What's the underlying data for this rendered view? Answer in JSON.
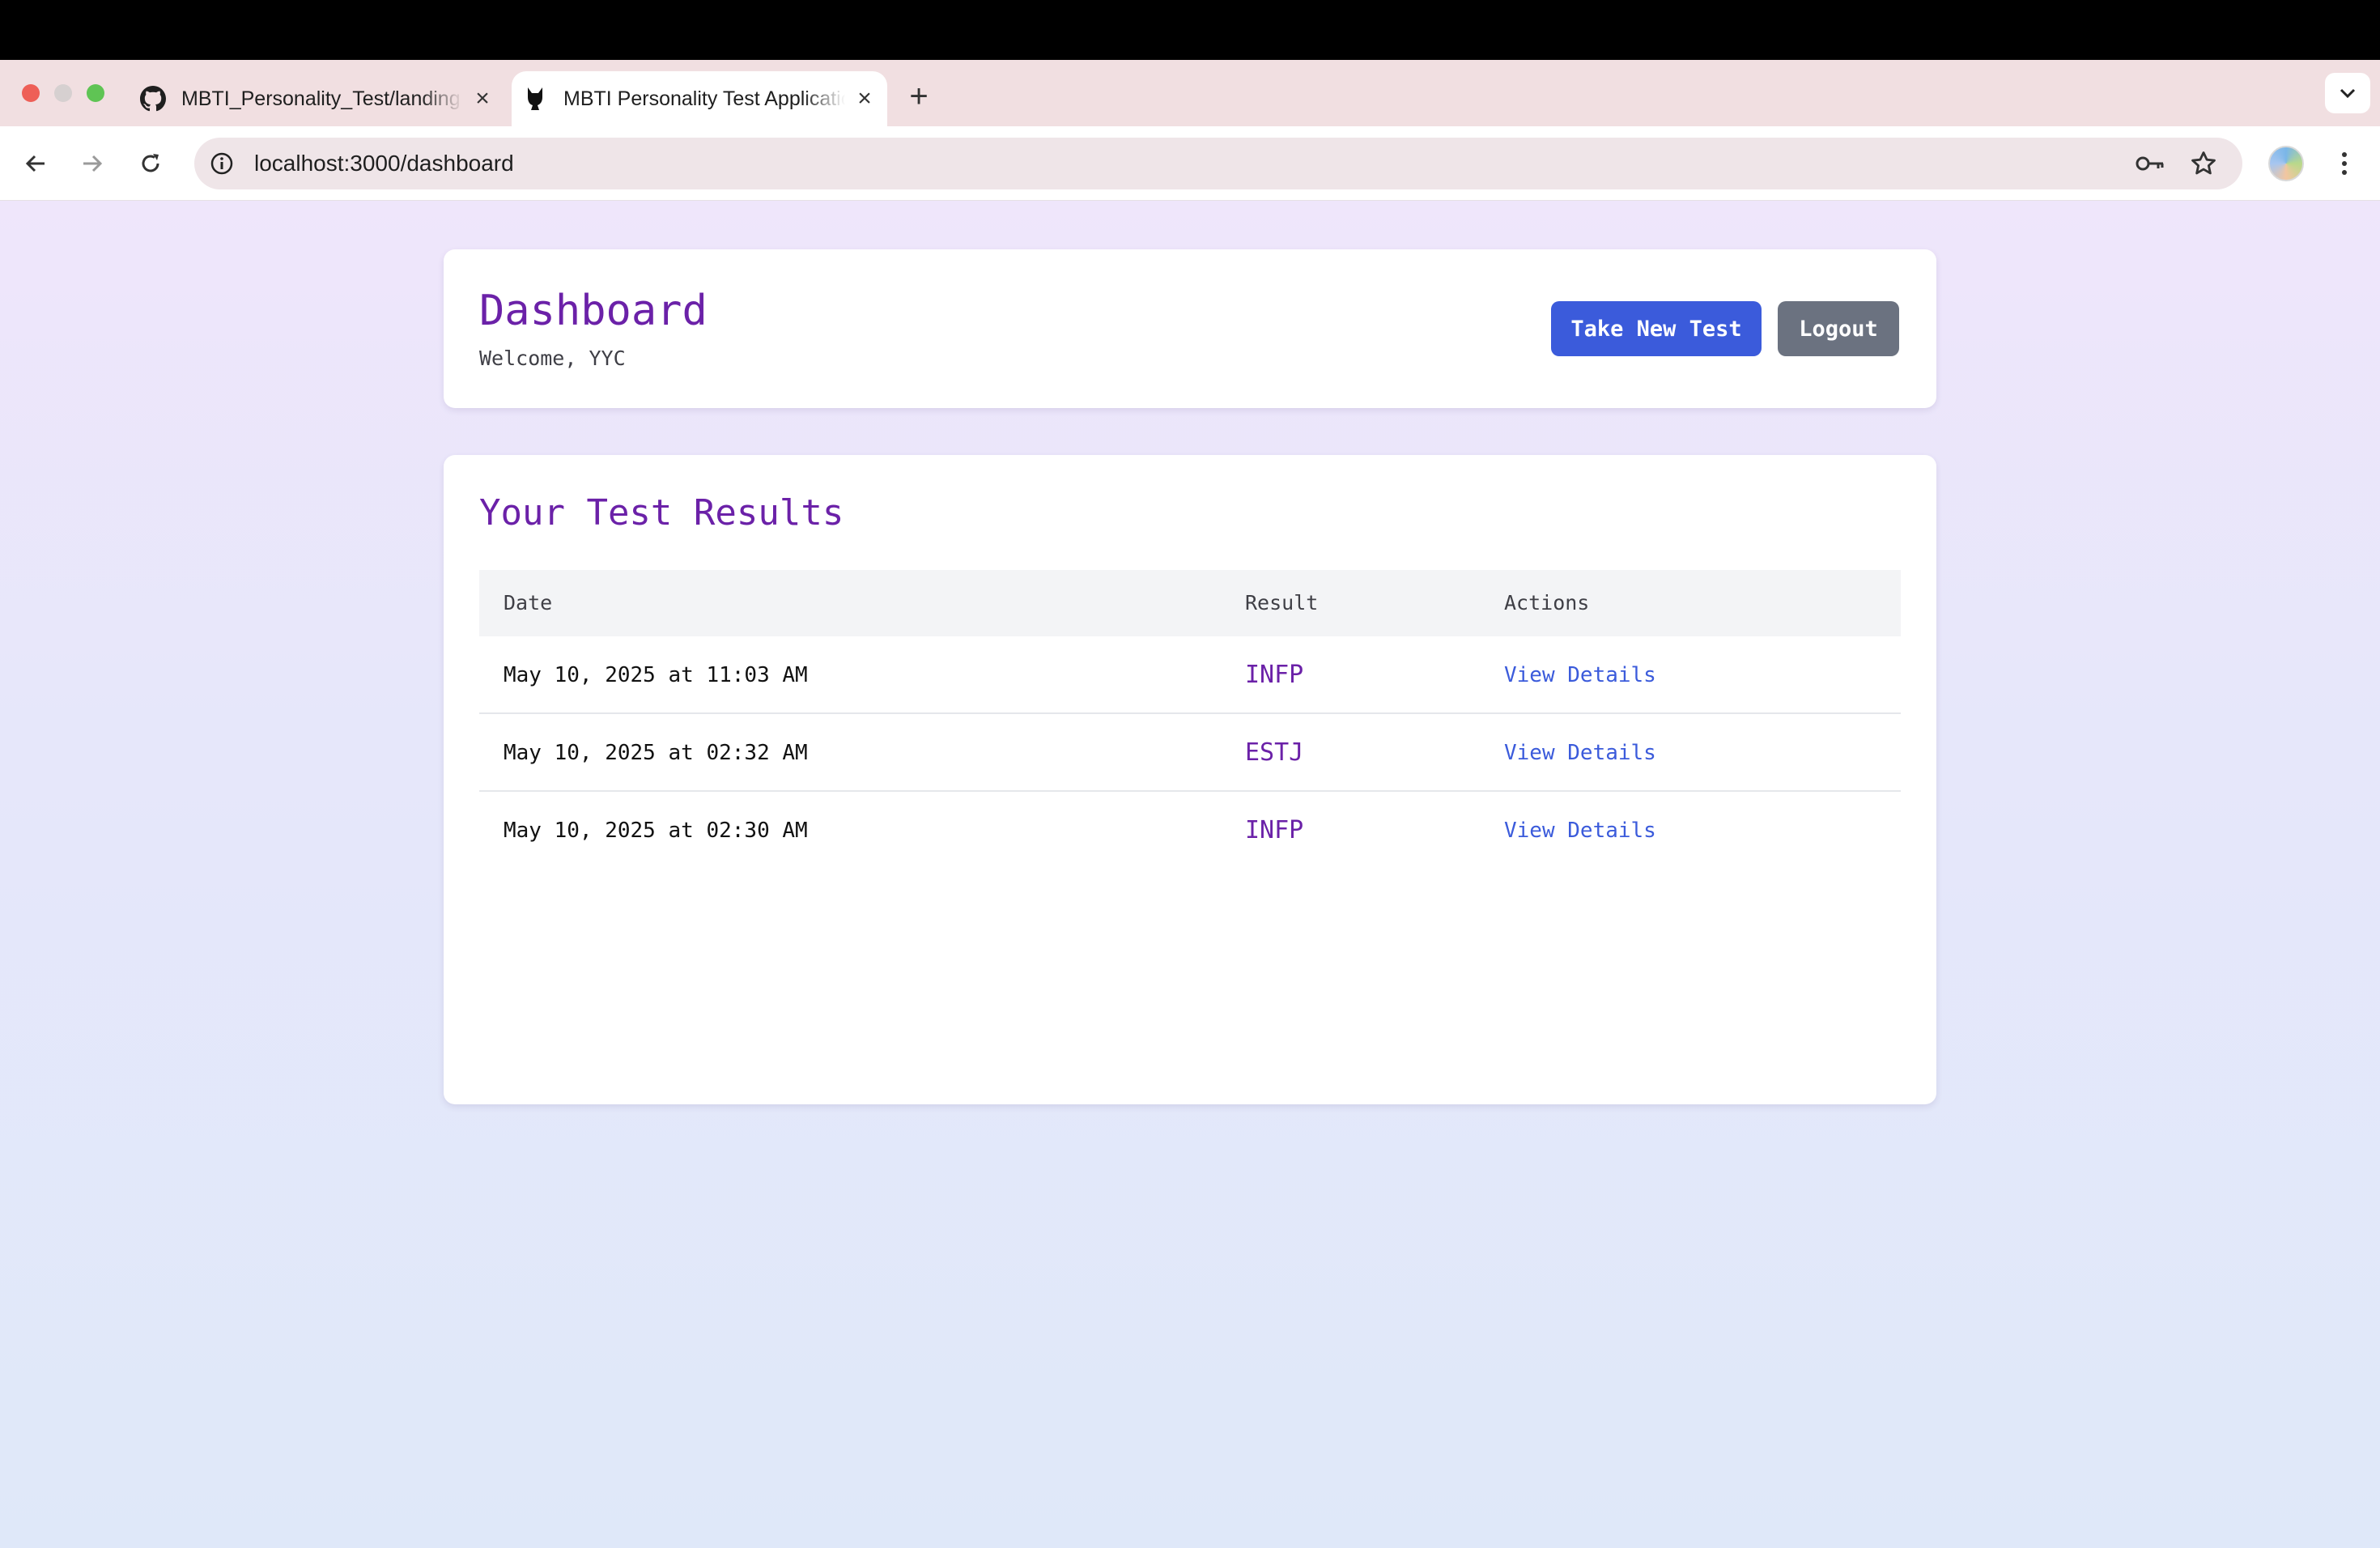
{
  "browser": {
    "tabs": [
      {
        "title": "MBTI_Personality_Test/landing",
        "icon": "github-icon"
      },
      {
        "title": "MBTI Personality Test Application",
        "icon": "cat-icon",
        "active": true
      }
    ],
    "url": "localhost:3000/dashboard"
  },
  "header": {
    "title": "Dashboard",
    "welcome": "Welcome, YYC",
    "take_new_test": "Take New Test",
    "logout": "Logout"
  },
  "results": {
    "title": "Your Test Results",
    "columns": [
      "Date",
      "Result",
      "Actions"
    ],
    "rows": [
      {
        "date": "May 10, 2025 at 11:03 AM",
        "result": "INFP",
        "action": "View Details"
      },
      {
        "date": "May 10, 2025 at 02:32 AM",
        "result": "ESTJ",
        "action": "View Details"
      },
      {
        "date": "May 10, 2025 at 02:30 AM",
        "result": "INFP",
        "action": "View Details"
      }
    ]
  },
  "colors": {
    "accent_purple": "#6b21a8",
    "primary_button": "#3b5bdb",
    "secondary_button": "#6b7280"
  }
}
